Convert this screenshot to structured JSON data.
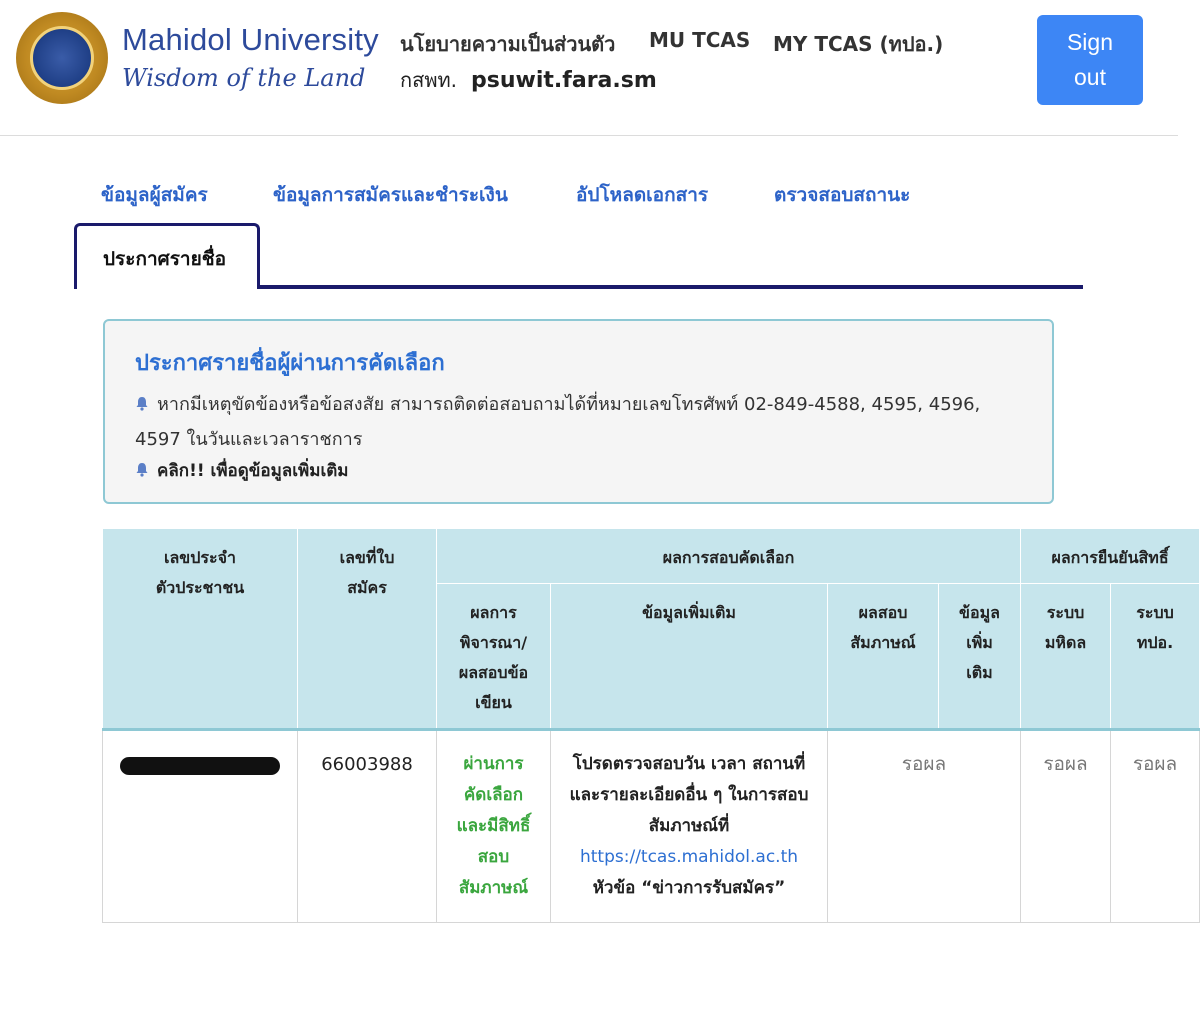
{
  "header": {
    "brand": "Mahidol University",
    "tagline": "Wisdom of the Land",
    "nav": [
      "นโยบายความเป็นส่วนตัว",
      "MU TCAS",
      "MY TCAS (ทปอ.)"
    ],
    "user_prefix": "กสพท.",
    "username": "psuwit.fara.sm",
    "signout_line1": "Sign",
    "signout_line2": "out"
  },
  "tabs": [
    "ข้อมูลผู้สมัคร",
    "ข้อมูลการสมัครและชำระเงิน",
    "อัปโหลดเอกสาร",
    "ตรวจสอบสถานะ"
  ],
  "active_tab": "ประกาศรายชื่อ",
  "notice": {
    "title": "ประกาศรายชื่อผู้ผ่านการคัดเลือก",
    "text": "หากมีเหตุขัดข้องหรือข้อสงสัย สามารถติดต่อสอบถามได้ที่หมายเลขโทรศัพท์ 02-849-4588, 4595, 4596, 4597 ในวันและเวลาราชการ",
    "link": "คลิก!! เพื่อดูข้อมูลเพิ่มเติม"
  },
  "table": {
    "headers": {
      "id": "เลขประจำตัวประชาชน",
      "app_no": "เลขที่ใบสมัคร",
      "exam_group": "ผลการสอบคัดเลือก",
      "confirm_group": "ผลการยืนยันสิทธิ์",
      "result": "ผลการพิจารณา/ผลสอบข้อเขียน",
      "more_info": "ข้อมูลเพิ่มเติม",
      "interview": "ผลสอบสัมภาษณ์",
      "extra": "ข้อมูลเพิ่มเติม",
      "mahidol": "ระบบมหิดล",
      "tpo": "ระบบทปอ."
    },
    "row": {
      "app_no": "66003988",
      "result": "ผ่านการคัดเลือกและมีสิทธิ์สอบสัมภาษณ์",
      "info_text": "โปรดตรวจสอบวัน เวลา สถานที่ และรายละเอียดอื่น ๆ ในการสอบสัมภาษณ์ที่",
      "info_link": "https://tcas.mahidol.ac.th",
      "info_suffix": "หัวข้อ “ข่าวการรับสมัคร”",
      "interview": "รอผล",
      "mahidol": "รอผล",
      "tpo": "รอผล"
    }
  },
  "colors": {
    "accent_blue": "#3d86f5",
    "tab_text": "#2d63c8",
    "tab_border": "#1a1a6b",
    "table_header": "#c6e5ec",
    "pass_green": "#3aa63e"
  },
  "icons": [
    "university-seal-logo",
    "bell-icon"
  ]
}
